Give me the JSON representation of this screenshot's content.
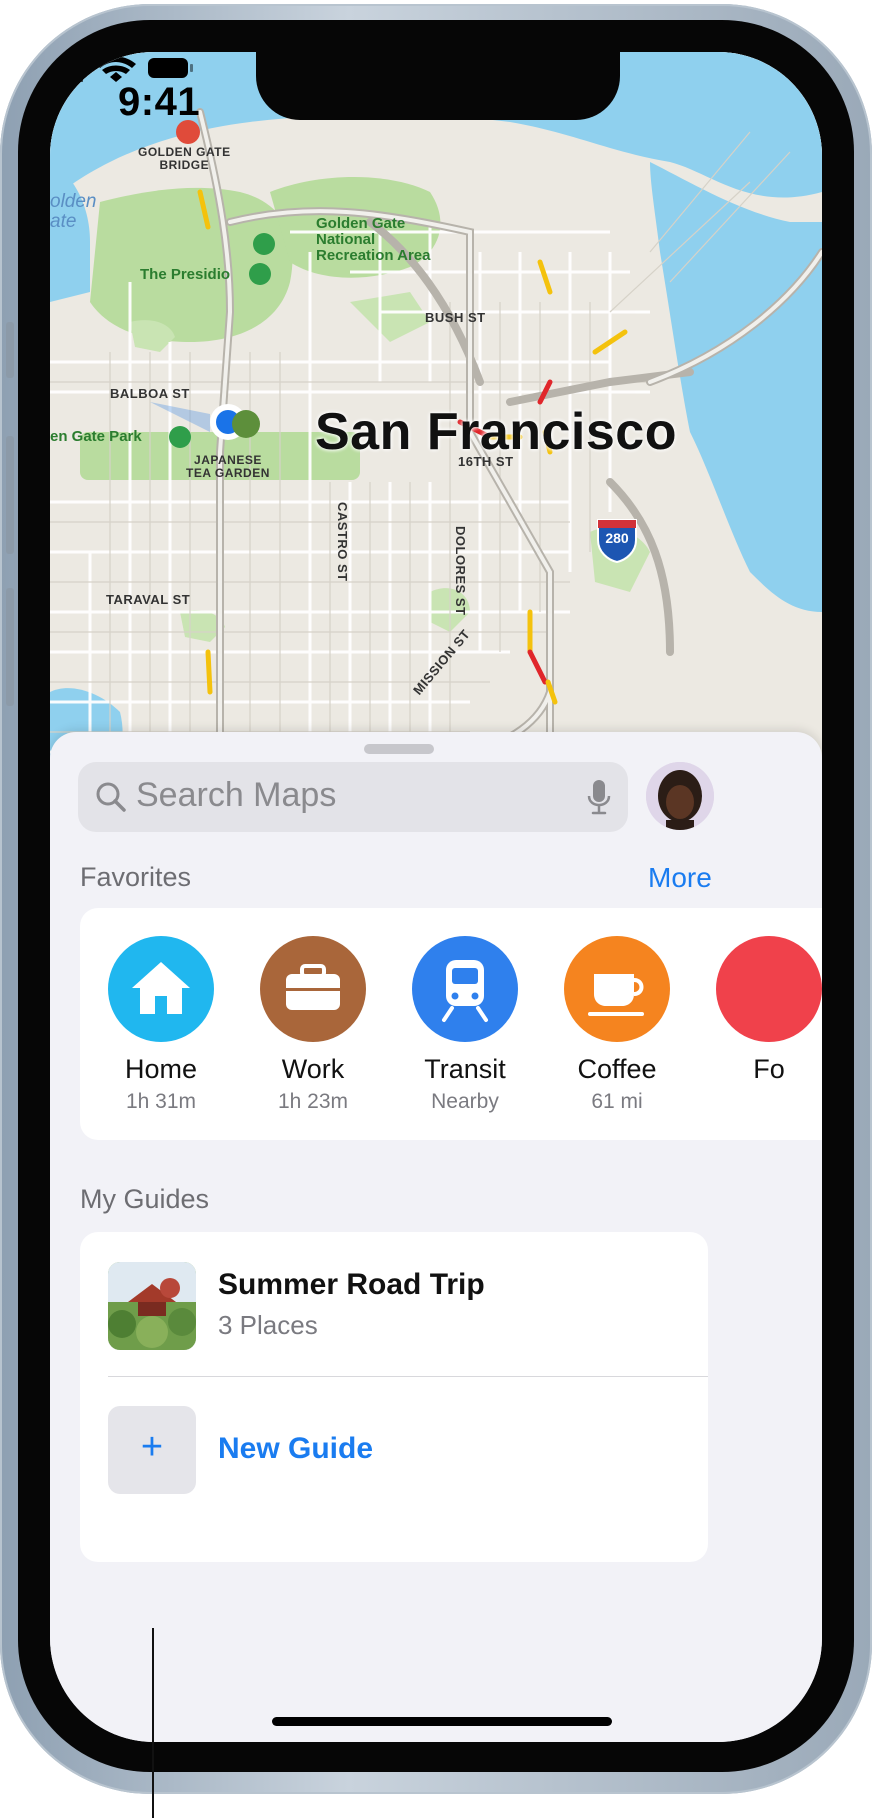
{
  "status_bar": {
    "time": "9:41"
  },
  "map": {
    "city": "San Francisco",
    "labels": {
      "golden_gate_bridge_1": "GOLDEN GATE",
      "golden_gate_bridge_2": "BRIDGE",
      "ggnra_1": "Golden Gate",
      "ggnra_2": "National",
      "ggnra_3": "Recreation Area",
      "presidio": "The Presidio",
      "bush_st": "BUSH ST",
      "balboa_st": "BALBOA ST",
      "gg_park": "en Gate Park",
      "japanese_tea_1": "JAPANESE",
      "japanese_tea_2": "TEA GARDEN",
      "castro_st": "CASTRO ST",
      "dolores_st": "DOLORES ST",
      "sixteenth_st": "16TH ST",
      "taraval_st": "TARAVAL ST",
      "mission_st": "MISSION ST",
      "water_1": "olden",
      "water_2": "ate",
      "highway": "280"
    }
  },
  "search": {
    "placeholder": "Search Maps"
  },
  "favorites": {
    "title": "Favorites",
    "more": "More",
    "items": [
      {
        "label": "Home",
        "sub": "1h 31m",
        "icon": "house-icon",
        "color": "#20b7ef"
      },
      {
        "label": "Work",
        "sub": "1h 23m",
        "icon": "briefcase-icon",
        "color": "#a9663a"
      },
      {
        "label": "Transit",
        "sub": "Nearby",
        "icon": "train-icon",
        "color": "#2f80ed"
      },
      {
        "label": "Coffee",
        "sub": "61 mi",
        "icon": "coffee-cup-icon",
        "color": "#f5841f"
      },
      {
        "label": "Fo",
        "sub": "",
        "icon": "food-icon",
        "color": "#f0414b"
      }
    ]
  },
  "guides": {
    "title": "My Guides",
    "items": [
      {
        "title": "Summer Road Trip",
        "sub": "3 Places"
      }
    ],
    "new_guide": "New Guide",
    "plus": "+"
  },
  "colors": {
    "accent": "#1a7cf0",
    "water": "#8fd0ee",
    "park": "#b9dc9f"
  }
}
